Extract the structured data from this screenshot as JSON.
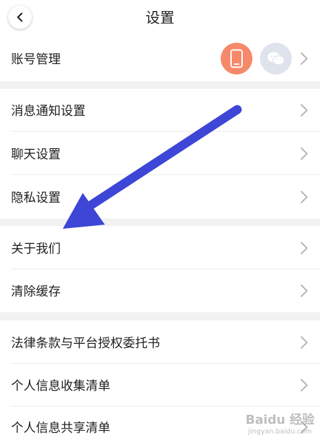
{
  "header": {
    "title": "设置"
  },
  "account": {
    "label": "账号管理",
    "phone_color": "#f5896a",
    "wechat_color": "#dfe3ec"
  },
  "section_notify": {
    "items": [
      {
        "label": "消息通知设置"
      },
      {
        "label": "聊天设置"
      },
      {
        "label": "隐私设置"
      }
    ]
  },
  "section_about": {
    "items": [
      {
        "label": "关于我们"
      },
      {
        "label": "清除缓存"
      }
    ]
  },
  "section_legal": {
    "items": [
      {
        "label": "法律条款与平台授权委托书"
      },
      {
        "label": "个人信息收集清单"
      },
      {
        "label": "个人信息共享清单"
      }
    ]
  },
  "annotation": {
    "arrow_color": "#3d46d6"
  },
  "watermark": {
    "brand": "Baidu 经验",
    "sub": "jingyan.baidu.com"
  }
}
